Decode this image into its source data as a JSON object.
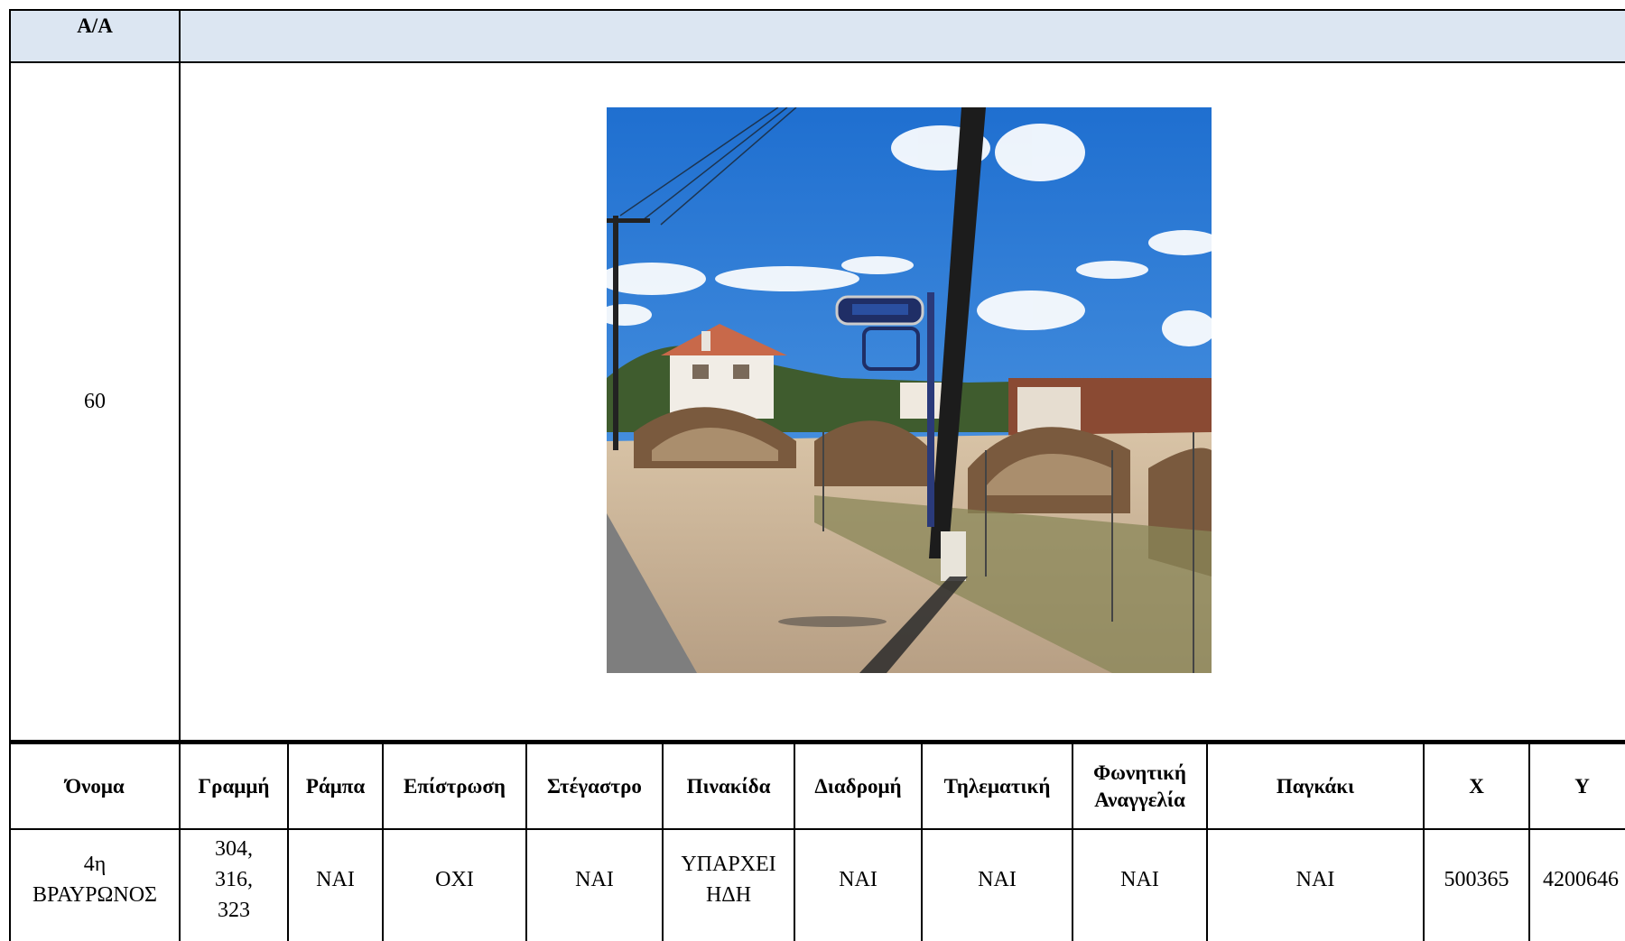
{
  "top_table": {
    "aa_header": "A/A",
    "aa_value": "60",
    "photo": {
      "description_icon": "bus-stop-photo",
      "sky_color": "#2f7fd6",
      "ground_color": "#cdb59a"
    }
  },
  "info_table": {
    "headers": {
      "name": "Όνομα",
      "line": "Γραμμή",
      "ramp": "Ράμπα",
      "paving": "Επίστρωση",
      "shelter": "Στέγαστρο",
      "sign": "Πινακίδα",
      "route": "Διαδρομή",
      "telematics": "Τηλεματική",
      "voice_1": "Φωνητική",
      "voice_2": "Αναγγελία",
      "bench": "Παγκάκι",
      "x": "X",
      "y": "Y"
    },
    "row": {
      "name_1": "4η",
      "name_2": "ΒΡΑΥΡΩΝΟΣ",
      "line_1": "304,",
      "line_2": "316,",
      "line_3": "323",
      "ramp": "ΝΑΙ",
      "paving": "ΟΧΙ",
      "shelter": "ΝΑΙ",
      "sign_1": "ΥΠΑΡΧΕΙ",
      "sign_2": "ΗΔΗ",
      "route": "ΝΑΙ",
      "telematics": "ΝΑΙ",
      "voice": "ΝΑΙ",
      "bench": "ΝΑΙ",
      "x": "500365",
      "y": "4200646"
    }
  }
}
